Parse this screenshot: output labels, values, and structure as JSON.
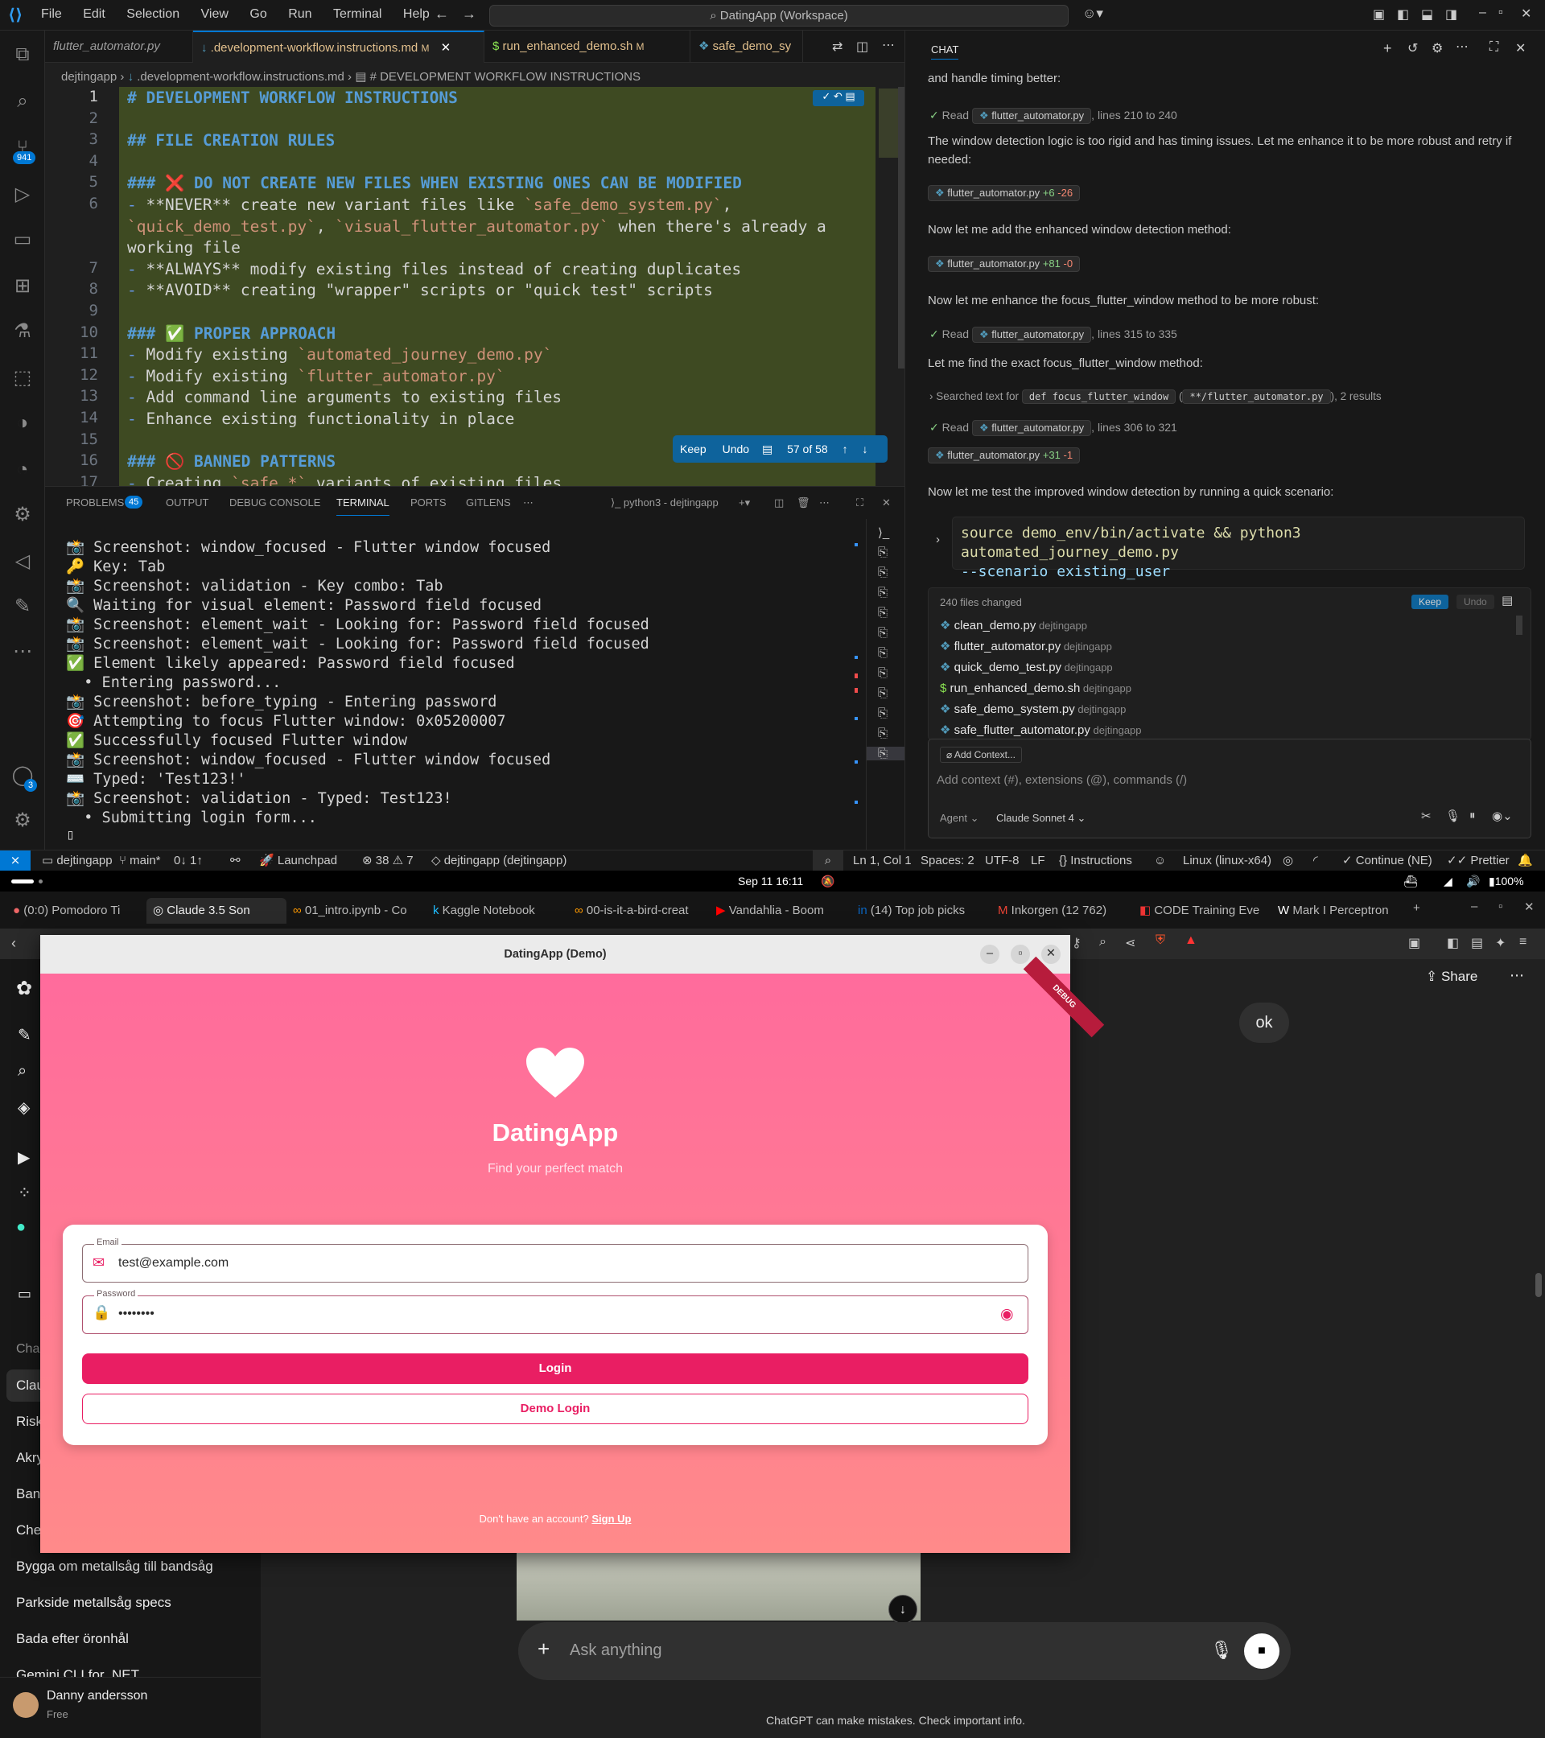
{
  "vscode": {
    "menu": [
      "File",
      "Edit",
      "Selection",
      "View",
      "Go",
      "Run",
      "Terminal",
      "Help"
    ],
    "command_center": "DatingApp (Workspace)",
    "scm_badge": "941",
    "accounts_badge": "3",
    "tabs": [
      {
        "label": "flutter_automator.py"
      },
      {
        "label": ".development-workflow.instructions.md",
        "marker": "M"
      },
      {
        "label": "run_enhanced_demo.sh",
        "marker": "M"
      },
      {
        "label": "safe_demo_sy"
      }
    ],
    "breadcrumb": [
      "dejtingapp",
      ".development-workflow.instructions.md",
      "# DEVELOPMENT WORKFLOW INSTRUCTIONS"
    ],
    "editor_lines": [
      {
        "n": "1",
        "t": "# DEVELOPMENT WORKFLOW INSTRUCTIONS",
        "k": "h"
      },
      {
        "n": "2",
        "t": "",
        "k": ""
      },
      {
        "n": "3",
        "t": "## FILE CREATION RULES",
        "k": "h"
      },
      {
        "n": "4",
        "t": "",
        "k": ""
      },
      {
        "n": "5",
        "t": "### ❌ DO NOT CREATE NEW FILES WHEN EXISTING ONES CAN BE MODIFIED",
        "k": "h"
      },
      {
        "n": "6",
        "t": "- **NEVER** create new variant files like `safe_demo_system.py`,",
        "k": "b"
      },
      {
        "n": "",
        "t": "`quick_demo_test.py`, `visual_flutter_automator.py` when there's already a",
        "k": "b"
      },
      {
        "n": "",
        "t": "working file",
        "k": ""
      },
      {
        "n": "7",
        "t": "- **ALWAYS** modify existing files instead of creating duplicates",
        "k": "b"
      },
      {
        "n": "8",
        "t": "- **AVOID** creating \"wrapper\" scripts or \"quick test\" scripts",
        "k": "b"
      },
      {
        "n": "9",
        "t": "",
        "k": ""
      },
      {
        "n": "10",
        "t": "### ✅ PROPER APPROACH",
        "k": "h"
      },
      {
        "n": "11",
        "t": "- Modify existing `automated_journey_demo.py`",
        "k": "b"
      },
      {
        "n": "12",
        "t": "- Modify existing `flutter_automator.py`",
        "k": "b"
      },
      {
        "n": "13",
        "t": "- Add command line arguments to existing files",
        "k": "b"
      },
      {
        "n": "14",
        "t": "- Enhance existing functionality in place",
        "k": "b"
      },
      {
        "n": "15",
        "t": "",
        "k": ""
      },
      {
        "n": "16",
        "t": "### 🚫 BANNED PATTERNS",
        "k": "h"
      },
      {
        "n": "17",
        "t": "- Creating `safe_*` variants of existing files",
        "k": "b"
      }
    ],
    "keepbar": {
      "keep": "Keep",
      "undo": "Undo",
      "count": "57 of 58"
    },
    "panel_tabs": {
      "problems": "PROBLEMS",
      "problems_count": "45",
      "output": "OUTPUT",
      "debug": "DEBUG CONSOLE",
      "terminal": "TERMINAL",
      "ports": "PORTS",
      "gitlens": "GITLENS",
      "shell": "python3 - dejtingapp"
    },
    "terminal_lines": [
      "📸 Screenshot: window_focused - Flutter window focused",
      "🔑 Key: Tab",
      "📸 Screenshot: validation - Key combo: Tab",
      "🔍 Waiting for visual element: Password field focused",
      "📸 Screenshot: element_wait - Looking for: Password field focused",
      "📸 Screenshot: element_wait - Looking for: Password field focused",
      "✅ Element likely appeared: Password field focused",
      "  • Entering password...",
      "📸 Screenshot: before_typing - Entering password",
      "🎯 Attempting to focus Flutter window: 0x05200007",
      "✅ Successfully focused Flutter window",
      "📸 Screenshot: window_focused - Flutter window focused",
      "⌨️ Typed: 'Test123!'",
      "📸 Screenshot: validation - Typed: Test123!",
      "  • Submitting login form..."
    ],
    "chat": {
      "header": "CHAT",
      "t1": "and handle timing better:",
      "read1": {
        "label": "Read",
        "file": "flutter_automator.py",
        "range": ", lines 210 to 240"
      },
      "t2": "The window detection logic is too rigid and has timing issues. Let me enhance it to be more robust and retry if needed:",
      "edit1": {
        "file": "flutter_automator.py",
        "plus": "+6",
        "minus": "-26"
      },
      "t3": "Now let me add the enhanced window detection method:",
      "edit2": {
        "file": "flutter_automator.py",
        "plus": "+81",
        "minus": "-0"
      },
      "t4": "Now let me enhance the focus_flutter_window method to be more robust:",
      "read2": {
        "label": "Read",
        "file": "flutter_automator.py",
        "range": ", lines 315 to 335"
      },
      "t5": "Let me find the exact focus_flutter_window method:",
      "search": {
        "prefix": "Searched text for",
        "q": "def focus_flutter_window",
        "glob": "**/flutter_automator.py",
        "suffix": ", 2 results"
      },
      "read3": {
        "label": "Read",
        "file": "flutter_automator.py",
        "range": ", lines 306 to 321"
      },
      "edit3": {
        "file": "flutter_automator.py",
        "plus": "+31",
        "minus": "-1"
      },
      "t6": "Now let me test the improved window detection by running a quick scenario:",
      "code1": "source demo_env/bin/activate && python3 automated_journey_demo.py",
      "code2": "--scenario existing_user",
      "changed_title": "240 files changed",
      "keep": "Keep",
      "undo": "Undo",
      "files": [
        {
          "name": "clean_demo.py",
          "dir": "dejtingapp",
          "icon": "python"
        },
        {
          "name": "flutter_automator.py",
          "dir": "dejtingapp",
          "icon": "python"
        },
        {
          "name": "quick_demo_test.py",
          "dir": "dejtingapp",
          "icon": "python"
        },
        {
          "name": "run_enhanced_demo.sh",
          "dir": "dejtingapp",
          "icon": "shell"
        },
        {
          "name": "safe_demo_system.py",
          "dir": "dejtingapp",
          "icon": "python"
        },
        {
          "name": "safe_flutter_automator.py",
          "dir": "dejtingapp",
          "icon": "python"
        }
      ],
      "add_context": "Add Context...",
      "input_placeholder": "Add context (#), extensions (@), commands (/)",
      "mode": "Agent",
      "model": "Claude Sonnet 4"
    },
    "status": {
      "folder": "dejtingapp",
      "branch": "main*",
      "sync": "0↓ 1↑",
      "launchpad": "Launchpad",
      "errors": "38",
      "warnings": "7",
      "workspace": "dejtingapp (dejtingapp)",
      "position": "Ln 1, Col 1",
      "spaces": "Spaces: 2",
      "encoding": "UTF-8",
      "eol": "LF",
      "lang": "Instructions",
      "os": "Linux (linux-x64)",
      "continue": "Continue (NE)",
      "prettier": "Prettier"
    }
  },
  "os": {
    "date": "Sep 11  16:11",
    "battery": "100%"
  },
  "browser": {
    "tabs": [
      "(0:0) Pomodoro Ti",
      "Claude 3.5 Son",
      "01_intro.ipynb - Co",
      "Kaggle Notebook",
      "00-is-it-a-bird-creat",
      "Vandahlia - Boom",
      "(14) Top job picks",
      "Inkorgen (12 762)",
      "CODE Training Eve",
      "Mark I Perceptron"
    ],
    "share": "Share",
    "user_msg": "ok",
    "sidebar_section": "Cha",
    "sidebar_items": [
      "Clau",
      "Risk",
      "Akry",
      "Ban",
      "Che",
      "Bygga om metallsåg till bandsåg",
      "Parkside metallsåg specs",
      "Bada efter öronhål",
      "Gemini CLI for .NET"
    ],
    "user_name": "Danny andersson",
    "user_plan": "Free",
    "ask_placeholder": "Ask anything",
    "disclaimer": "ChatGPT can make mistakes. Check important info."
  },
  "flutter": {
    "window_title": "DatingApp (Demo)",
    "debug": "DEBUG",
    "app_name": "DatingApp",
    "tagline": "Find your perfect match",
    "email_label": "Email",
    "email_value": "test@example.com",
    "password_label": "Password",
    "password_value": "••••••••",
    "login": "Login",
    "demo_login": "Demo Login",
    "no_account": "Don't have an account?",
    "signup": "Sign Up",
    "colors": {
      "gradient_top": "#ff6b9c",
      "gradient_bottom": "#ff8a8a",
      "primary": "#e91e63"
    }
  }
}
